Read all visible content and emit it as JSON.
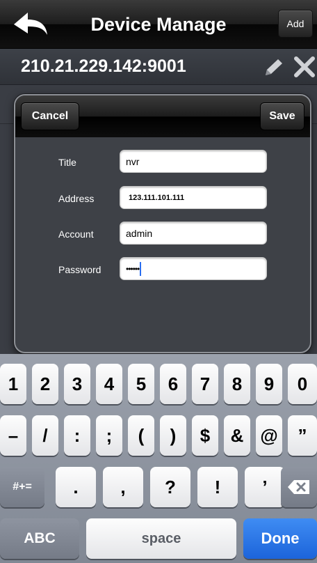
{
  "header": {
    "title": "Device Manage",
    "add_label": "Add",
    "back_icon": "back-arrow-icon"
  },
  "device": {
    "address": "210.21.229.142:9001",
    "edit_icon": "pencil-icon",
    "delete_icon": "close-icon"
  },
  "dialog": {
    "cancel_label": "Cancel",
    "save_label": "Save",
    "fields": [
      {
        "label": "Title",
        "value": "nvr"
      },
      {
        "label": "Address",
        "value": "123.111.101.111"
      },
      {
        "label": "Account",
        "value": "admin"
      },
      {
        "label": "Password",
        "value": "••••••"
      }
    ]
  },
  "keyboard": {
    "row1": [
      "1",
      "2",
      "3",
      "4",
      "5",
      "6",
      "7",
      "8",
      "9",
      "0"
    ],
    "row2": [
      "–",
      "/",
      ":",
      ";",
      "(",
      ")",
      "$",
      "&",
      "@",
      "”"
    ],
    "row3": [
      "#+=",
      ".",
      ",",
      "?",
      "!",
      "’"
    ],
    "delete_icon": "backspace-icon",
    "abc_label": "ABC",
    "space_label": "space",
    "done_label": "Done"
  }
}
